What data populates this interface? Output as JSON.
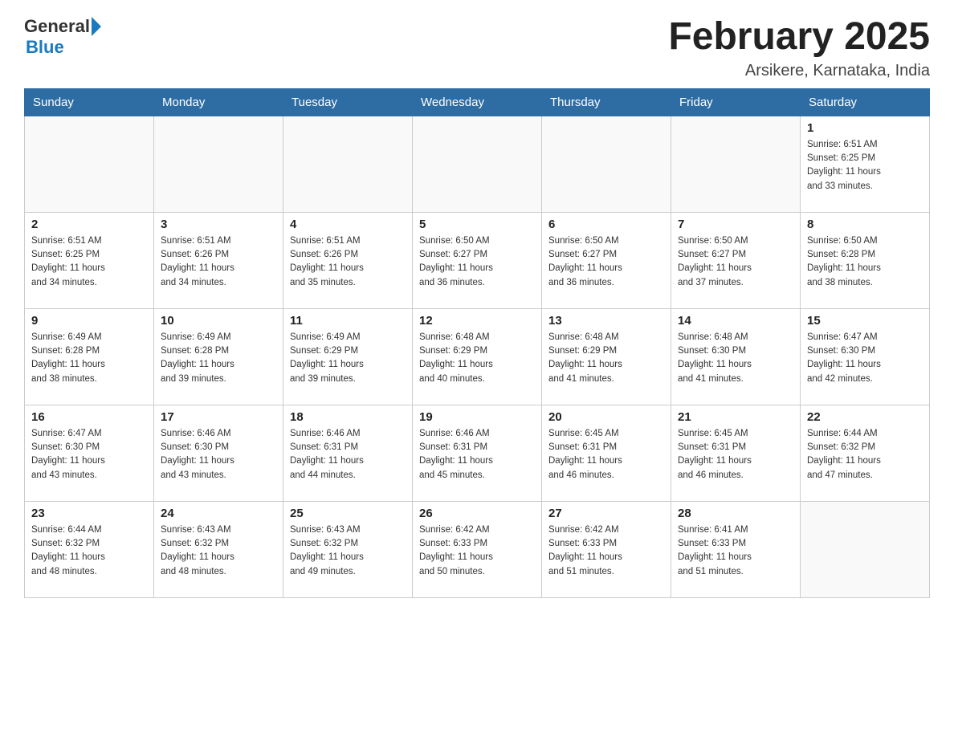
{
  "header": {
    "logo_general": "General",
    "logo_blue": "Blue",
    "title": "February 2025",
    "subtitle": "Arsikere, Karnataka, India"
  },
  "days_of_week": [
    "Sunday",
    "Monday",
    "Tuesday",
    "Wednesday",
    "Thursday",
    "Friday",
    "Saturday"
  ],
  "weeks": [
    [
      {
        "day": "",
        "info": ""
      },
      {
        "day": "",
        "info": ""
      },
      {
        "day": "",
        "info": ""
      },
      {
        "day": "",
        "info": ""
      },
      {
        "day": "",
        "info": ""
      },
      {
        "day": "",
        "info": ""
      },
      {
        "day": "1",
        "info": "Sunrise: 6:51 AM\nSunset: 6:25 PM\nDaylight: 11 hours\nand 33 minutes."
      }
    ],
    [
      {
        "day": "2",
        "info": "Sunrise: 6:51 AM\nSunset: 6:25 PM\nDaylight: 11 hours\nand 34 minutes."
      },
      {
        "day": "3",
        "info": "Sunrise: 6:51 AM\nSunset: 6:26 PM\nDaylight: 11 hours\nand 34 minutes."
      },
      {
        "day": "4",
        "info": "Sunrise: 6:51 AM\nSunset: 6:26 PM\nDaylight: 11 hours\nand 35 minutes."
      },
      {
        "day": "5",
        "info": "Sunrise: 6:50 AM\nSunset: 6:27 PM\nDaylight: 11 hours\nand 36 minutes."
      },
      {
        "day": "6",
        "info": "Sunrise: 6:50 AM\nSunset: 6:27 PM\nDaylight: 11 hours\nand 36 minutes."
      },
      {
        "day": "7",
        "info": "Sunrise: 6:50 AM\nSunset: 6:27 PM\nDaylight: 11 hours\nand 37 minutes."
      },
      {
        "day": "8",
        "info": "Sunrise: 6:50 AM\nSunset: 6:28 PM\nDaylight: 11 hours\nand 38 minutes."
      }
    ],
    [
      {
        "day": "9",
        "info": "Sunrise: 6:49 AM\nSunset: 6:28 PM\nDaylight: 11 hours\nand 38 minutes."
      },
      {
        "day": "10",
        "info": "Sunrise: 6:49 AM\nSunset: 6:28 PM\nDaylight: 11 hours\nand 39 minutes."
      },
      {
        "day": "11",
        "info": "Sunrise: 6:49 AM\nSunset: 6:29 PM\nDaylight: 11 hours\nand 39 minutes."
      },
      {
        "day": "12",
        "info": "Sunrise: 6:48 AM\nSunset: 6:29 PM\nDaylight: 11 hours\nand 40 minutes."
      },
      {
        "day": "13",
        "info": "Sunrise: 6:48 AM\nSunset: 6:29 PM\nDaylight: 11 hours\nand 41 minutes."
      },
      {
        "day": "14",
        "info": "Sunrise: 6:48 AM\nSunset: 6:30 PM\nDaylight: 11 hours\nand 41 minutes."
      },
      {
        "day": "15",
        "info": "Sunrise: 6:47 AM\nSunset: 6:30 PM\nDaylight: 11 hours\nand 42 minutes."
      }
    ],
    [
      {
        "day": "16",
        "info": "Sunrise: 6:47 AM\nSunset: 6:30 PM\nDaylight: 11 hours\nand 43 minutes."
      },
      {
        "day": "17",
        "info": "Sunrise: 6:46 AM\nSunset: 6:30 PM\nDaylight: 11 hours\nand 43 minutes."
      },
      {
        "day": "18",
        "info": "Sunrise: 6:46 AM\nSunset: 6:31 PM\nDaylight: 11 hours\nand 44 minutes."
      },
      {
        "day": "19",
        "info": "Sunrise: 6:46 AM\nSunset: 6:31 PM\nDaylight: 11 hours\nand 45 minutes."
      },
      {
        "day": "20",
        "info": "Sunrise: 6:45 AM\nSunset: 6:31 PM\nDaylight: 11 hours\nand 46 minutes."
      },
      {
        "day": "21",
        "info": "Sunrise: 6:45 AM\nSunset: 6:31 PM\nDaylight: 11 hours\nand 46 minutes."
      },
      {
        "day": "22",
        "info": "Sunrise: 6:44 AM\nSunset: 6:32 PM\nDaylight: 11 hours\nand 47 minutes."
      }
    ],
    [
      {
        "day": "23",
        "info": "Sunrise: 6:44 AM\nSunset: 6:32 PM\nDaylight: 11 hours\nand 48 minutes."
      },
      {
        "day": "24",
        "info": "Sunrise: 6:43 AM\nSunset: 6:32 PM\nDaylight: 11 hours\nand 48 minutes."
      },
      {
        "day": "25",
        "info": "Sunrise: 6:43 AM\nSunset: 6:32 PM\nDaylight: 11 hours\nand 49 minutes."
      },
      {
        "day": "26",
        "info": "Sunrise: 6:42 AM\nSunset: 6:33 PM\nDaylight: 11 hours\nand 50 minutes."
      },
      {
        "day": "27",
        "info": "Sunrise: 6:42 AM\nSunset: 6:33 PM\nDaylight: 11 hours\nand 51 minutes."
      },
      {
        "day": "28",
        "info": "Sunrise: 6:41 AM\nSunset: 6:33 PM\nDaylight: 11 hours\nand 51 minutes."
      },
      {
        "day": "",
        "info": ""
      }
    ]
  ]
}
